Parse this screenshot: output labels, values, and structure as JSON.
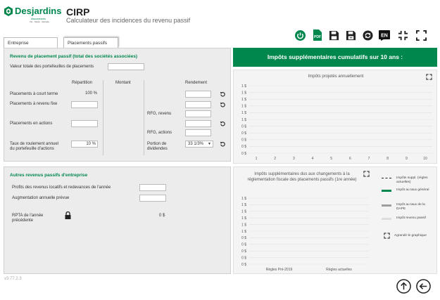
{
  "brand": {
    "name": "Desjardins",
    "sub": "Assurances",
    "tagline": "Vie · Santé · Retraite"
  },
  "app": {
    "title": "CIRP",
    "subtitle": "Calculateur des incidences du revenu passif"
  },
  "toolbar": {
    "icons": [
      "power-icon",
      "pdf-icon",
      "save-icon",
      "save-as-icon",
      "refresh-icon",
      "language-icon",
      "collapse-icon",
      "expand-icon"
    ],
    "lang_label": "EN",
    "pdf_label": "PDF",
    "accent": "#00874e"
  },
  "tabs": [
    {
      "label": "Entreprise"
    },
    {
      "label": "Placements passifs"
    }
  ],
  "section1": {
    "title": "Revenu de placement passif (total des sociétés associées)",
    "total_label": "Valeur totale des portefeuilles de placements",
    "total_value": "",
    "col_repartition": "Répartition",
    "col_montant": "Montant",
    "col_rendement": "Rendement",
    "row_court_terme": "Placements à court terme",
    "court_terme_pct": "100 %",
    "row_revenu_fixe": "Placements à revenu fixe",
    "row_actions": "Placements en actions",
    "rfg_revenu": "RFG, revenu",
    "rfg_actions": "RFG, actions",
    "taux_label_1": "Taux de roulement annuel",
    "taux_label_2": "du portefeuille d'actions",
    "taux_value": "10 %",
    "dividendes_label_1": "Portion de",
    "dividendes_label_2": "dividendes",
    "dividendes_value": "33 1/3%"
  },
  "section2": {
    "title": "Autres revenus passifs d'entreprise",
    "profits_label": "Profits des revenus locatifs et redevances de l'année",
    "augmentation_label": "Augmentation annuelle prévue",
    "rpta_label_1": "RPTA de l'année",
    "rpta_label_2": "précédente",
    "rpta_value": "0 $"
  },
  "banner": {
    "text": "Impôts supplémentaires cumulatifs sur 10 ans :",
    "color": "#00874e"
  },
  "chart_data": [
    {
      "type": "line",
      "title": "Impôts projetés annuellement",
      "x": [
        1,
        2,
        3,
        4,
        5,
        6,
        7,
        8,
        9,
        10
      ],
      "y_ticks": [
        "1 $",
        "1 $",
        "1 $",
        "1 $",
        "1 $",
        "1 $",
        "0 $",
        "0 $",
        "0 $",
        "0 $",
        "0 $"
      ],
      "series": []
    },
    {
      "type": "bar",
      "title": "Impôts supplémentaires dus aux changements à la réglementation fiscale des placements passifs (1re année)",
      "categories": [
        "Règles Pré-2019",
        "Règles actuelles"
      ],
      "y_ticks": [
        "1 $",
        "1 $",
        "1 $",
        "1 $",
        "1 $",
        "1 $",
        "0 $",
        "0 $",
        "0 $",
        "0 $",
        "0 $"
      ],
      "series": [],
      "legend": [
        {
          "label": "Impôts suppl. (règles actuelles)",
          "color": "#222222",
          "style": "dashed"
        },
        {
          "label": "Impôt au taux général",
          "color": "#00874e",
          "style": "solid"
        },
        {
          "label": "Impôt au taux de la DAPE",
          "color": "#9e9e9e",
          "style": "solid"
        },
        {
          "label": "Impôt revenu passif",
          "color": "#dddddd",
          "style": "solid"
        }
      ]
    }
  ],
  "chart2": {
    "enlarge_label": "Agrandir le graphique"
  },
  "version": "v3.77.2.3"
}
